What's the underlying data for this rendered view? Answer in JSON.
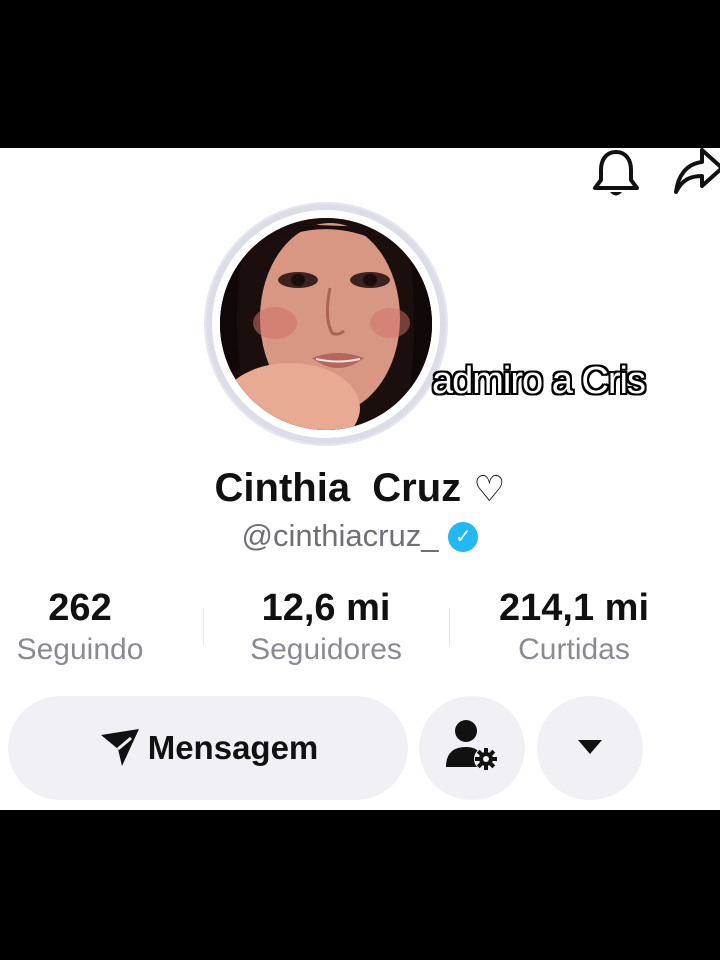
{
  "overlay_caption": "admiro a Cris",
  "profile": {
    "name": "Cinthia  Cruz",
    "name_suffix": "♡",
    "handle": "@cinthiacruz_",
    "verified": true
  },
  "stats": [
    {
      "value": "262",
      "label": "Seguindo"
    },
    {
      "value": "12,6 mi",
      "label": "Seguidores"
    },
    {
      "value": "214,1 mi",
      "label": "Curtidas"
    }
  ],
  "actions": {
    "message_label": "Mensagem"
  },
  "colors": {
    "verified_badge": "#20b8f5",
    "button_bg": "#f1f1f5",
    "secondary_text": "#6f6f78"
  },
  "icons": [
    "bell-icon",
    "share-icon",
    "send-icon",
    "add-friend-icon",
    "caret-down-icon",
    "verified-icon"
  ]
}
